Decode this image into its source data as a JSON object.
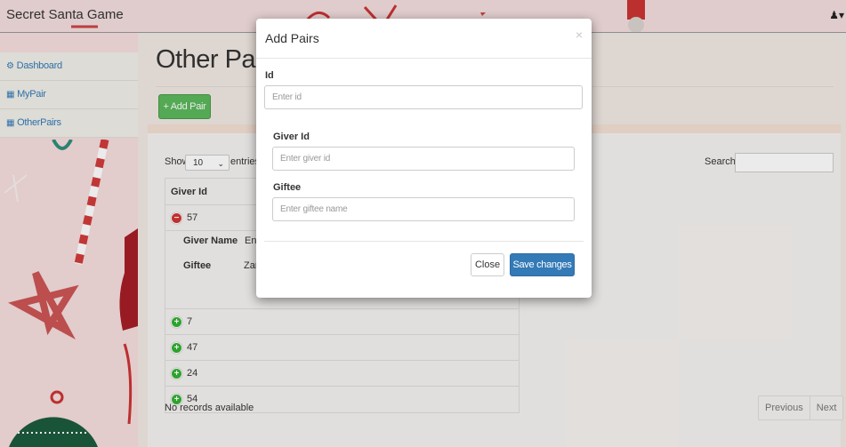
{
  "navbar": {
    "brand": "Secret Santa Game",
    "user_icon": "user-icon",
    "user_caret": "▾"
  },
  "sidebar": {
    "items": [
      {
        "label": "Dashboard",
        "icon": "dashboard-icon",
        "glyph": "⚙"
      },
      {
        "label": "MyPair",
        "icon": "table-icon",
        "glyph": "▦"
      },
      {
        "label": "OtherPairs",
        "icon": "table-icon",
        "glyph": "▦"
      }
    ]
  },
  "main": {
    "title": "Other Pairs",
    "add_button": "+ Add Pair",
    "table_controls": {
      "show_label": "Show",
      "length_value": "10",
      "entries_label": "entries",
      "search_label": "Search:"
    },
    "table": {
      "header": "Giver Id",
      "rows": [
        {
          "value": "57",
          "expanded": true
        },
        {
          "value": "7",
          "expanded": false
        },
        {
          "value": "47",
          "expanded": false
        },
        {
          "value": "24",
          "expanded": false
        },
        {
          "value": "54",
          "expanded": false
        }
      ],
      "child": {
        "giver_name_label": "Giver Name",
        "giver_name_value": "Ena",
        "giftee_label": "Giftee",
        "giftee_value": "Zara"
      }
    },
    "info": "No records available",
    "pagination": {
      "previous": "Previous",
      "next": "Next"
    }
  },
  "modal": {
    "title": "Add Pairs",
    "close_symbol": "×",
    "fields": {
      "id": {
        "label": "Id",
        "placeholder": "Enter id"
      },
      "giver_id": {
        "label": "Giver Id",
        "placeholder": "Enter giver id"
      },
      "giftee": {
        "label": "Giftee",
        "placeholder": "Enter giftee name"
      }
    },
    "close_button": "Close",
    "save_button": "Save changes"
  },
  "colors": {
    "primary": "#337ab7",
    "success": "#5cb85c",
    "danger": "#d33333"
  }
}
